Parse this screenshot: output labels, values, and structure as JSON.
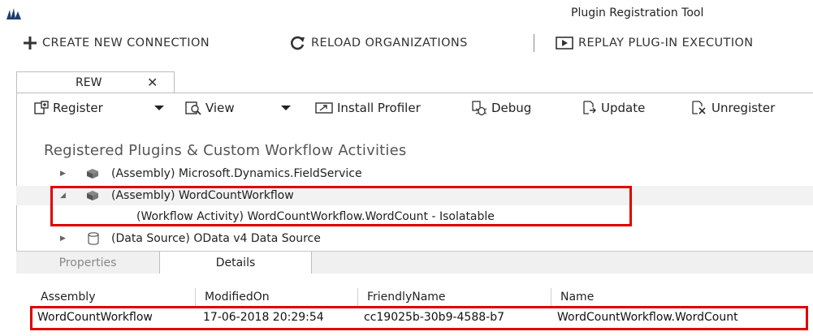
{
  "window": {
    "title": "Plugin Registration Tool"
  },
  "main_toolbar": {
    "create_connection": "CREATE NEW CONNECTION",
    "reload_organizations": "RELOAD ORGANIZATIONS",
    "replay_execution": "REPLAY PLUG-IN EXECUTION"
  },
  "document_tab": {
    "label": "REW",
    "close": "✕"
  },
  "toolbar": {
    "register": "Register",
    "view": "View",
    "install_profiler": "Install Profiler",
    "debug": "Debug",
    "update": "Update",
    "unregister": "Unregister"
  },
  "section": {
    "title": "Registered Plugins & Custom Workflow Activities"
  },
  "tree": {
    "items": [
      {
        "label": "(Assembly) Microsoft.Dynamics.FieldService",
        "icon": "assembly-icon",
        "expander": "collapsed"
      },
      {
        "label": "(Assembly) WordCountWorkflow",
        "icon": "assembly-icon",
        "expander": "expanded"
      },
      {
        "label": "(Workflow Activity) WordCountWorkflow.WordCount - Isolatable",
        "icon": "none",
        "expander": "none"
      },
      {
        "label": "(Data Source) OData v4 Data Source",
        "icon": "data-source-icon",
        "expander": "collapsed"
      }
    ]
  },
  "bottom_tabs": {
    "properties": "Properties",
    "details": "Details"
  },
  "details_grid": {
    "columns": [
      "Assembly",
      "ModifiedOn",
      "FriendlyName",
      "Name"
    ],
    "rows": [
      [
        "WordCountWorkflow",
        "17-06-2018 20:29:54",
        "cc19025b-30b9-4588-b7",
        "WordCountWorkflow.WordCount"
      ]
    ]
  },
  "colors": {
    "highlight": "#e00000",
    "logo": "#1f3c6e"
  }
}
